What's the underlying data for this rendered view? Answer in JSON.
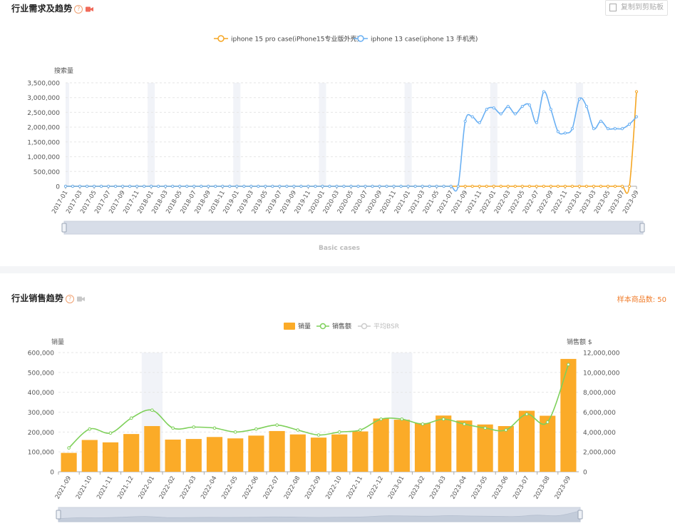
{
  "panel1": {
    "title": "行业需求及趋势",
    "copy_button": "复制到剪贴板",
    "dataZoom_label": "Basic cases"
  },
  "panel2": {
    "title": "行业销售趋势",
    "sample_label": "样本商品数: 50"
  },
  "colors": {
    "orange": "#f5a623",
    "blue": "#6ab0f3",
    "green": "#7ed05a",
    "bar": "#fbab28",
    "grid": "#e6e6e6",
    "band": "#f1f3f8"
  },
  "chart_data": [
    {
      "type": "line",
      "ylabel": "搜索量",
      "ylim": [
        0,
        3500000
      ],
      "yticks": [
        "3,500,000",
        "3,000,000",
        "2,500,000",
        "2,000,000",
        "1,500,000",
        "1,000,000",
        "500,000",
        "0"
      ],
      "x": [
        "2017-01",
        "2017-02",
        "2017-03",
        "2017-04",
        "2017-05",
        "2017-06",
        "2017-07",
        "2017-08",
        "2017-09",
        "2017-10",
        "2017-11",
        "2017-12",
        "2018-01",
        "2018-02",
        "2018-03",
        "2018-04",
        "2018-05",
        "2018-06",
        "2018-07",
        "2018-08",
        "2018-09",
        "2018-10",
        "2018-11",
        "2018-12",
        "2019-01",
        "2019-02",
        "2019-03",
        "2019-04",
        "2019-05",
        "2019-06",
        "2019-07",
        "2019-08",
        "2019-09",
        "2019-10",
        "2019-11",
        "2019-12",
        "2020-01",
        "2020-02",
        "2020-03",
        "2020-04",
        "2020-05",
        "2020-06",
        "2020-07",
        "2020-08",
        "2020-09",
        "2020-10",
        "2020-11",
        "2020-12",
        "2021-01",
        "2021-02",
        "2021-03",
        "2021-04",
        "2021-05",
        "2021-06",
        "2021-07",
        "2021-08",
        "2021-09",
        "2021-10",
        "2021-11",
        "2021-12",
        "2022-01",
        "2022-02",
        "2022-03",
        "2022-04",
        "2022-05",
        "2022-06",
        "2022-07",
        "2022-08",
        "2022-09",
        "2022-10",
        "2022-11",
        "2022-12",
        "2023-01",
        "2023-02",
        "2023-03",
        "2023-04",
        "2023-05",
        "2023-06",
        "2023-07",
        "2023-08",
        "2023-09"
      ],
      "series": [
        {
          "name": "iphone 15 pro case(iPhone15专业版外壳)",
          "color": "#f5a623",
          "values": [
            0,
            0,
            0,
            0,
            0,
            0,
            0,
            0,
            0,
            0,
            0,
            0,
            0,
            0,
            0,
            0,
            0,
            0,
            0,
            0,
            0,
            0,
            0,
            0,
            0,
            0,
            0,
            0,
            0,
            0,
            0,
            0,
            0,
            0,
            0,
            0,
            0,
            0,
            0,
            0,
            0,
            0,
            0,
            0,
            0,
            0,
            0,
            0,
            0,
            0,
            0,
            0,
            0,
            0,
            0,
            0,
            0,
            0,
            0,
            0,
            0,
            0,
            0,
            0,
            0,
            0,
            0,
            0,
            0,
            0,
            0,
            0,
            0,
            0,
            0,
            0,
            0,
            0,
            0,
            0,
            3200000
          ]
        },
        {
          "name": "iphone 13 case(iphone 13 手机壳)",
          "color": "#6ab0f3",
          "values": [
            0,
            0,
            0,
            0,
            0,
            0,
            0,
            0,
            0,
            0,
            0,
            0,
            0,
            0,
            0,
            0,
            0,
            0,
            0,
            0,
            0,
            0,
            0,
            0,
            0,
            0,
            0,
            0,
            0,
            0,
            0,
            0,
            0,
            0,
            0,
            0,
            0,
            0,
            0,
            0,
            0,
            0,
            0,
            0,
            0,
            0,
            0,
            0,
            0,
            0,
            0,
            0,
            0,
            0,
            0,
            0,
            2200000,
            2350000,
            2150000,
            2600000,
            2650000,
            2450000,
            2700000,
            2450000,
            2700000,
            2750000,
            2150000,
            3200000,
            2600000,
            1850000,
            1800000,
            1950000,
            2950000,
            2700000,
            1950000,
            2200000,
            1950000,
            1950000,
            1950000,
            2100000,
            2350000
          ]
        }
      ],
      "x_ticks_shown": [
        "2017-01",
        "2017-03",
        "2017-05",
        "2017-07",
        "2017-09",
        "2017-11",
        "2018-01",
        "2018-03",
        "2018-05",
        "2018-07",
        "2018-09",
        "2018-11",
        "2019-01",
        "2019-03",
        "2019-05",
        "2019-07",
        "2019-09",
        "2019-11",
        "2020-01",
        "2020-03",
        "2020-05",
        "2020-07",
        "2020-09",
        "2020-11",
        "2021-01",
        "2021-03",
        "2021-05",
        "2021-07",
        "2021-09",
        "2021-11",
        "2022-01",
        "2022-03",
        "2022-05",
        "2022-07",
        "2022-09",
        "2022-11",
        "2023-01",
        "2023-03",
        "2023-05",
        "2023-07",
        "2023-09"
      ]
    },
    {
      "type": "bar",
      "ylabel_left": "销量",
      "ylabel_right": "销售额 $",
      "ylim_left": [
        0,
        600000
      ],
      "ylim_right": [
        0,
        12000000
      ],
      "yticks_left": [
        "600,000",
        "500,000",
        "400,000",
        "300,000",
        "200,000",
        "100,000",
        "0"
      ],
      "yticks_right": [
        "12,000,000",
        "10,000,000",
        "8,000,000",
        "6,000,000",
        "4,000,000",
        "2,000,000",
        "0"
      ],
      "categories": [
        "2021-09",
        "2021-10",
        "2021-11",
        "2021-12",
        "2022-01",
        "2022-02",
        "2022-03",
        "2022-04",
        "2022-05",
        "2022-06",
        "2022-07",
        "2022-08",
        "2022-09",
        "2022-10",
        "2022-11",
        "2022-12",
        "2023-01",
        "2023-02",
        "2023-03",
        "2023-04",
        "2023-05",
        "2023-06",
        "2023-07",
        "2023-08",
        "2023-09"
      ],
      "series": [
        {
          "name": "销量",
          "color": "#fbab28",
          "values": [
            95000,
            160000,
            148000,
            190000,
            230000,
            162000,
            165000,
            175000,
            168000,
            182000,
            205000,
            188000,
            172000,
            188000,
            203000,
            268000,
            262000,
            245000,
            283000,
            258000,
            238000,
            230000,
            307000,
            282000,
            568000
          ]
        },
        {
          "name": "销售额",
          "color": "#7ed05a",
          "values": [
            2400000,
            4300000,
            3900000,
            5400000,
            6200000,
            4400000,
            4500000,
            4400000,
            4000000,
            4300000,
            4700000,
            4200000,
            3700000,
            4000000,
            4200000,
            5300000,
            5300000,
            4800000,
            5300000,
            4800000,
            4400000,
            4200000,
            5800000,
            5000000,
            10800000
          ]
        },
        {
          "name": "平均BSR",
          "color": "#cccccc",
          "values": []
        }
      ]
    }
  ]
}
